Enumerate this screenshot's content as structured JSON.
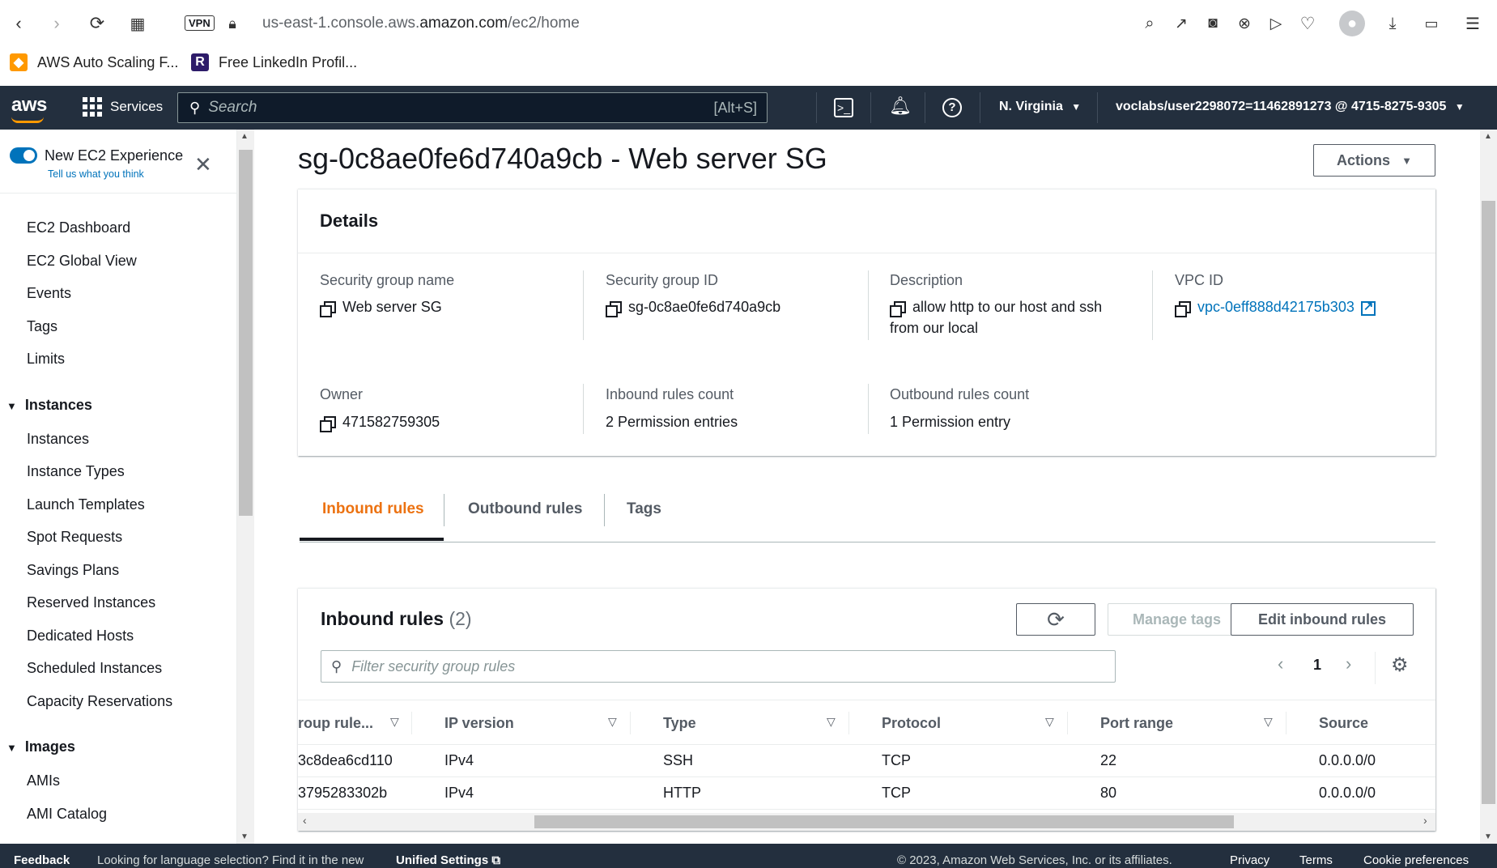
{
  "browser": {
    "url_prefix": "us-east-1.console.aws.",
    "url_domain": "amazon.com",
    "url_path": "/ec2/home",
    "vpn_label": "VPN",
    "bookmarks": [
      {
        "label": "AWS Auto Scaling F...",
        "icon": "aws-cube-icon",
        "color": "#ff9900"
      },
      {
        "label": "Free LinkedIn Profil...",
        "icon": "r-logo-icon",
        "color": "#2d1b69"
      }
    ]
  },
  "aws_header": {
    "logo": "aws",
    "services_label": "Services",
    "search_placeholder": "Search",
    "search_shortcut": "[Alt+S]",
    "region": "N. Virginia",
    "account": "voclabs/user2298072=11462891273 @ 4715-8275-9305"
  },
  "sidebar": {
    "toggle_label": "New EC2 Experience",
    "toggle_sub": "Tell us what you think",
    "items": [
      "EC2 Dashboard",
      "EC2 Global View",
      "Events",
      "Tags",
      "Limits"
    ],
    "sections": [
      {
        "title": "Instances",
        "items": [
          "Instances",
          "Instance Types",
          "Launch Templates",
          "Spot Requests",
          "Savings Plans",
          "Reserved Instances",
          "Dedicated Hosts",
          "Scheduled Instances",
          "Capacity Reservations"
        ]
      },
      {
        "title": "Images",
        "items": [
          "AMIs",
          "AMI Catalog"
        ]
      }
    ]
  },
  "page": {
    "title": "sg-0c8ae0fe6d740a9cb - Web server SG",
    "actions_label": "Actions"
  },
  "details": {
    "title": "Details",
    "sg_name_label": "Security group name",
    "sg_name": "Web server SG",
    "sg_id_label": "Security group ID",
    "sg_id": "sg-0c8ae0fe6d740a9cb",
    "description_label": "Description",
    "description_line1": "allow http to our host and ssh",
    "description_line2": "from our local",
    "vpc_label": "VPC ID",
    "vpc_id": "vpc-0eff888d42175b303",
    "owner_label": "Owner",
    "owner": "471582759305",
    "inbound_count_label": "Inbound rules count",
    "inbound_count": "2 Permission entries",
    "outbound_count_label": "Outbound rules count",
    "outbound_count": "1 Permission entry"
  },
  "tabs": [
    "Inbound rules",
    "Outbound rules",
    "Tags"
  ],
  "rules": {
    "title": "Inbound rules",
    "count": "(2)",
    "manage_tags_label": "Manage tags",
    "edit_label": "Edit inbound rules",
    "filter_placeholder": "Filter security group rules",
    "page": "1",
    "columns": [
      "roup rule...",
      "IP version",
      "Type",
      "Protocol",
      "Port range",
      "Source"
    ],
    "rows": [
      [
        "3c8dea6cd110",
        "IPv4",
        "SSH",
        "TCP",
        "22",
        "0.0.0.0/0"
      ],
      [
        "3795283302b",
        "IPv4",
        "HTTP",
        "TCP",
        "80",
        "0.0.0.0/0"
      ]
    ]
  },
  "footer": {
    "feedback": "Feedback",
    "lang_text": "Looking for language selection? Find it in the new",
    "unified_settings": "Unified Settings",
    "copyright": "© 2023, Amazon Web Services, Inc. or its affiliates.",
    "privacy": "Privacy",
    "terms": "Terms",
    "cookies": "Cookie preferences"
  }
}
